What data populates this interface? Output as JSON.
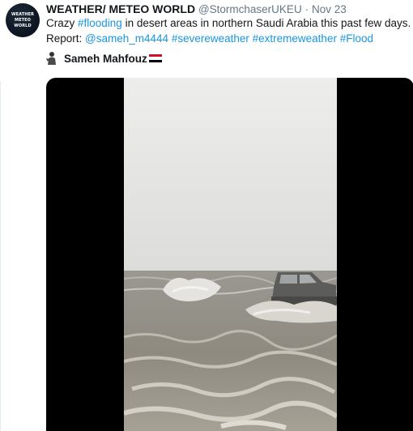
{
  "author": {
    "avatar_text": [
      "WEATHER",
      "METEO",
      "WORLD"
    ],
    "display_name": "WEATHER/ METEO WORLD",
    "handle": "@StormchaserUKEU",
    "separator": "·",
    "date": "Nov 23"
  },
  "tweet": {
    "line1_prefix": "Crazy ",
    "line1_hashtag": "#flooding",
    "line1_suffix": " in desert areas in northern Saudi Arabia this past few days.",
    "report_label": "Report: ",
    "mention": "@sameh_m4444",
    "hashtags": [
      "#severeweather",
      "#extremeweather",
      "#Flood"
    ]
  },
  "credit": {
    "name": "Sameh Mahfouz"
  },
  "colors": {
    "link": "#1b95e0",
    "text": "#14171a",
    "muted": "#657786"
  }
}
